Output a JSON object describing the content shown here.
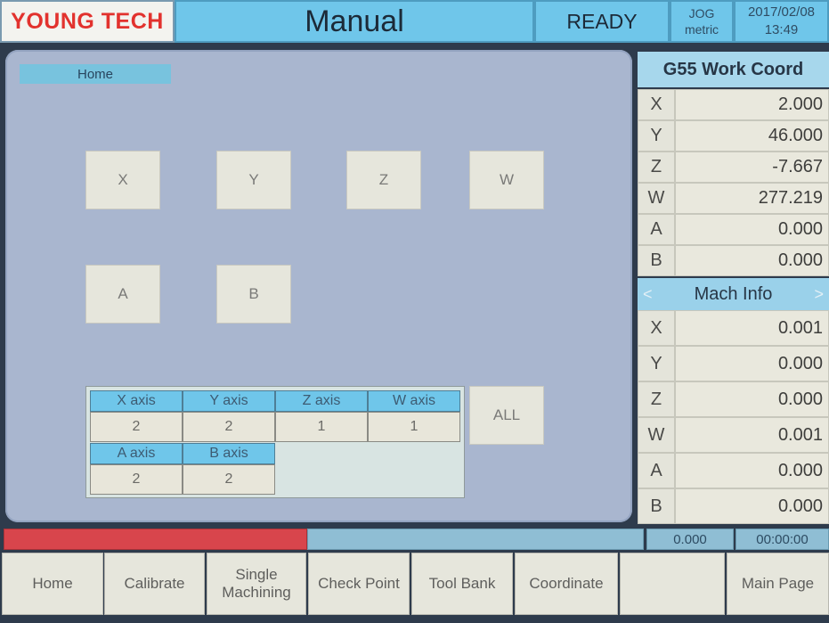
{
  "header": {
    "brand": "YOUNG TECH",
    "title": "Manual",
    "status": "READY",
    "mode": "JOG",
    "units": "metric",
    "date": "2017/02/08",
    "time": "13:49"
  },
  "main": {
    "breadcrumb": "Home",
    "axis_buttons": [
      "X",
      "Y",
      "Z",
      "W",
      "A",
      "B"
    ],
    "all_button": "ALL",
    "axis_table": {
      "headers": [
        "X axis",
        "Y axis",
        "Z axis",
        "W axis",
        "A axis",
        "B axis"
      ],
      "values": [
        "2",
        "2",
        "1",
        "1",
        "2",
        "2"
      ]
    }
  },
  "work_coord": {
    "title": "G55 Work Coord",
    "rows": [
      {
        "axis": "X",
        "value": "2.000"
      },
      {
        "axis": "Y",
        "value": "46.000"
      },
      {
        "axis": "Z",
        "value": "-7.667"
      },
      {
        "axis": "W",
        "value": "277.219"
      },
      {
        "axis": "A",
        "value": "0.000"
      },
      {
        "axis": "B",
        "value": "0.000"
      }
    ]
  },
  "mach_info": {
    "title": "Mach Info",
    "left_arrow": "<",
    "right_arrow": ">",
    "rows": [
      {
        "axis": "X",
        "value": "0.001"
      },
      {
        "axis": "Y",
        "value": "0.000"
      },
      {
        "axis": "Z",
        "value": "0.000"
      },
      {
        "axis": "W",
        "value": "0.001"
      },
      {
        "axis": "A",
        "value": "0.000"
      },
      {
        "axis": "B",
        "value": "0.000"
      }
    ]
  },
  "progress": {
    "counter": "0.000",
    "elapsed": "00:00:00"
  },
  "function_keys": {
    "home": "Home",
    "calibrate": "Calibrate",
    "single_1": "Single",
    "single_2": "Machining",
    "check_point": "Check Point",
    "tool_bank": "Tool Bank",
    "coordinate": "Coordinate",
    "blank": "",
    "main_page": "Main Page"
  },
  "colors": {
    "accent": "#6fc6ea",
    "brand_red": "#e2322e",
    "panel": "#a9b6cf",
    "progress_red": "#d8454c"
  }
}
